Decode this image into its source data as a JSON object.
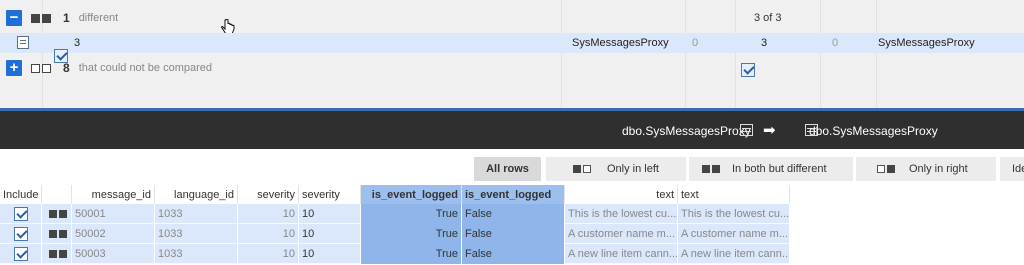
{
  "groups": {
    "different": {
      "toggle": "−",
      "count": "1",
      "label": "different",
      "pager": "3 of 3"
    },
    "detail": {
      "left_id": "3",
      "left_object": "SysMessagesProxy",
      "left_count": "0",
      "right_id": "3",
      "right_count": "0",
      "right_object": "SysMessagesProxy"
    },
    "not_compared": {
      "toggle": "+",
      "count": "8",
      "label": "that could not be compared"
    }
  },
  "object_header": {
    "left": "dbo.SysMessagesProxy",
    "arrow": "➡",
    "right": "dbo.SysMessagesProxy"
  },
  "filters": {
    "all_rows": "All rows",
    "only_left": "Only in left",
    "both_different": "In both but different",
    "only_right": "Only in right",
    "identical": "Ide"
  },
  "table": {
    "headers": {
      "include": "Include",
      "message_id": "message_id",
      "language_id": "language_id",
      "severity_l": "severity",
      "severity_r": "severity",
      "is_event_logged_l": "is_event_logged",
      "is_event_logged_r": "is_event_logged",
      "text_l": "text",
      "text_r": "text"
    },
    "rows": [
      {
        "message_id": "50001",
        "language_id": "1033",
        "sev_l": "10",
        "sev_r": "10",
        "iel_l": "True",
        "iel_r": "False",
        "text_l": "This is the lowest cu...",
        "text_r": "This is the lowest cu..."
      },
      {
        "message_id": "50002",
        "language_id": "1033",
        "sev_l": "10",
        "sev_r": "10",
        "iel_l": "True",
        "iel_r": "False",
        "text_l": "A customer name m...",
        "text_r": "A customer name m..."
      },
      {
        "message_id": "50003",
        "language_id": "1033",
        "sev_l": "10",
        "sev_r": "10",
        "iel_l": "True",
        "iel_r": "False",
        "text_l": "A new line item cann...",
        "text_r": "A new line item cann..."
      }
    ]
  },
  "colors": {
    "accent": "#1f6fd6",
    "row_bg": "#dbe8fb",
    "highlight": "#8fb5ea",
    "dark_bar": "#2f2f2f"
  }
}
